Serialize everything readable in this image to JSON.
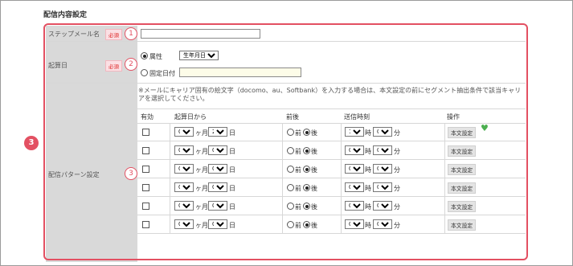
{
  "section_title": "配信内容設定",
  "rows": {
    "step_name": {
      "label": "ステップメール名",
      "required": "必須",
      "marker": "1",
      "value": ""
    },
    "base_date": {
      "label": "起算日",
      "required": "必須",
      "marker": "2",
      "opt_attr_label": "属性",
      "opt_attr_select": "生年月日",
      "opt_fixed_label": "固定日付",
      "fixed_value": ""
    },
    "pattern": {
      "label": "配信パターン設定",
      "marker": "3",
      "note": "※メールにキャリア固有の絵文字（docomo、au、Softbank）を入力する場合は、本文設定の前にセグメント抽出条件で該当キャリアを選択してください。",
      "headers": [
        "有効",
        "起算日から",
        "前後",
        "送信時刻",
        "操作"
      ]
    }
  },
  "big_marker": "3",
  "unit": {
    "month": "ヶ月",
    "day": "日",
    "before": "前",
    "after": "後",
    "hour": "時",
    "minute": "分"
  },
  "button_label": "本文設定",
  "pattern_rows": [
    {
      "months": "0",
      "days": "2",
      "hour": "12",
      "minute": "0",
      "after": true,
      "heart": true
    },
    {
      "months": "0",
      "days": "0",
      "hour": "0",
      "minute": "0",
      "after": true,
      "heart": false
    },
    {
      "months": "0",
      "days": "0",
      "hour": "0",
      "minute": "0",
      "after": true,
      "heart": false
    },
    {
      "months": "0",
      "days": "0",
      "hour": "0",
      "minute": "0",
      "after": true,
      "heart": false
    },
    {
      "months": "0",
      "days": "0",
      "hour": "0",
      "minute": "0",
      "after": true,
      "heart": false
    },
    {
      "months": "0",
      "days": "0",
      "hour": "0",
      "minute": "0",
      "after": true,
      "heart": false
    }
  ],
  "colors": {
    "accent": "#e35062",
    "heart": "#4caf50",
    "label_bg": "#d9d9d9"
  }
}
